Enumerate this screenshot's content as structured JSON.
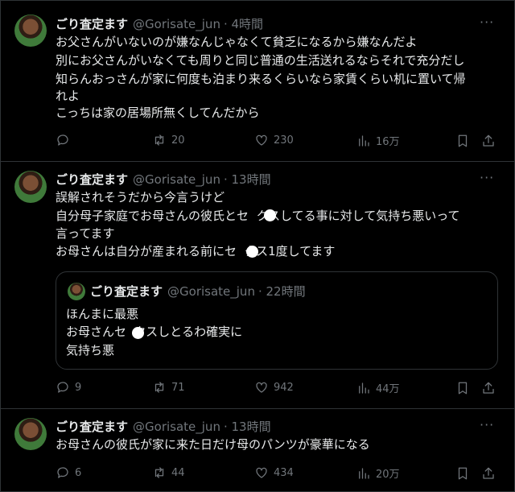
{
  "tweets": [
    {
      "name": "ごり査定ます",
      "handle": "@Gorisate_jun",
      "time": "· 4時間",
      "lines": [
        "お父さんがいないのが嫌なんじゃなくて貧乏になるから嫌なんだよ",
        "別にお父さんがいなくても周りと同じ普通の生活送れるならそれで充分だし",
        "知らんおっさんが家に何度も泊まり来るくらいなら家賃くらい机に置いて帰",
        "れよ",
        "こっちは家の居場所無くしてんだから"
      ],
      "replies": "",
      "retweets": "20",
      "likes": "230",
      "views": "16万"
    },
    {
      "name": "ごり査定ます",
      "handle": "@Gorisate_jun",
      "time": "· 13時間",
      "lines": [
        "誤解されそうだから今言うけど",
        "自分母子家庭でお母さんの彼氏とセ  クスしてる事に対して気持ち悪いって",
        "言ってます",
        "お母さんは自分が産まれる前にセ  クス1度してます"
      ],
      "quote": {
        "name": "ごり査定ます",
        "handle": "@Gorisate_jun",
        "time": "· 22時間",
        "lines": [
          "ほんまに最悪",
          "お母さんセ  クスしとるわ確実に",
          "気持ち悪"
        ]
      },
      "replies": "9",
      "retweets": "71",
      "likes": "942",
      "views": "44万"
    },
    {
      "name": "ごり査定ます",
      "handle": "@Gorisate_jun",
      "time": "· 13時間",
      "lines": [
        "お母さんの彼氏が家に来た日だけ母のパンツが豪華になる"
      ],
      "replies": "6",
      "retweets": "44",
      "likes": "434",
      "views": "20万"
    }
  ],
  "more_icon": "···",
  "colors": {
    "background": "#000000",
    "text": "#e7e9ea",
    "muted": "#71767b",
    "border": "#2f3336"
  }
}
